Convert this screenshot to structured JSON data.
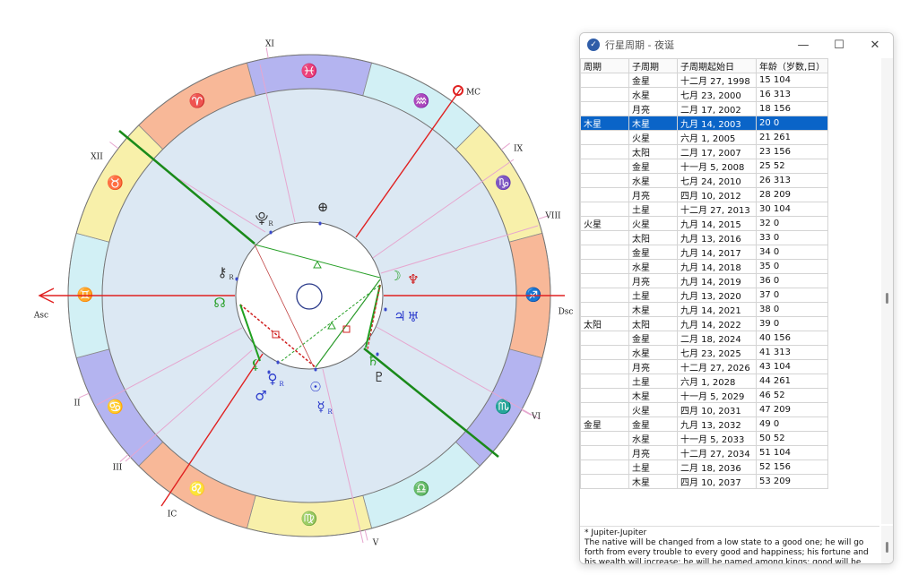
{
  "chart": {
    "angles": {
      "asc": "Asc",
      "dsc": "Dsc",
      "mc": "MC",
      "ic": "IC"
    },
    "houses": [
      "II",
      "III",
      "V",
      "VI",
      "VIII",
      "IX",
      "XI",
      "XII"
    ],
    "signs": [
      {
        "name": "pisces",
        "glyph": "♓",
        "color": "#b4b4f0"
      },
      {
        "name": "aquarius",
        "glyph": "♒",
        "color": "#d2f0f5"
      },
      {
        "name": "capricorn",
        "glyph": "♑",
        "color": "#f8f0aa"
      },
      {
        "name": "sagittarius",
        "glyph": "♐",
        "color": "#f8b898"
      },
      {
        "name": "scorpio",
        "glyph": "♏",
        "color": "#b4b4f0"
      },
      {
        "name": "libra",
        "glyph": "♎",
        "color": "#d2f0f5"
      },
      {
        "name": "virgo",
        "glyph": "♍",
        "color": "#f8f0aa"
      },
      {
        "name": "leo",
        "glyph": "♌",
        "color": "#f8b898"
      },
      {
        "name": "cancer",
        "glyph": "♋",
        "color": "#b4b4f0"
      },
      {
        "name": "gemini",
        "glyph": "♊",
        "color": "#d2f0f5"
      },
      {
        "name": "taurus",
        "glyph": "♉",
        "color": "#f8f0aa"
      },
      {
        "name": "aries",
        "glyph": "♈",
        "color": "#f8b898"
      }
    ],
    "planets": {
      "pluto_r": "⯓",
      "fortune": "⊕",
      "chiron_r": "⚷",
      "node": "☊",
      "moon": "☽",
      "neptune": "♆",
      "jupiter": "♃",
      "uranus": "♅",
      "saturn": "♄",
      "pluto": "♇",
      "venus_r": "♀",
      "mars": "♂",
      "sun": "☉",
      "mercury_r": "☿",
      "lilith": "⚸",
      "retro": "R"
    }
  },
  "window": {
    "title": "行星周期 - 夜诞",
    "controls": {
      "minimize": "—",
      "maximize": "☐",
      "close": "✕"
    },
    "columns": [
      "周期",
      "子周期",
      "子周期起始日",
      "年龄（岁数,日）"
    ],
    "rows": [
      [
        "",
        "金星",
        "十二月 27, 1998",
        "15 104"
      ],
      [
        "",
        "水星",
        "七月 23, 2000",
        "16 313"
      ],
      [
        "",
        "月亮",
        "二月 17, 2002",
        "18 156"
      ],
      [
        "木星",
        "木星",
        "九月 14, 2003",
        "20 0"
      ],
      [
        "",
        "火星",
        "六月 1, 2005",
        "21 261"
      ],
      [
        "",
        "太阳",
        "二月 17, 2007",
        "23 156"
      ],
      [
        "",
        "金星",
        "十一月 5, 2008",
        "25 52"
      ],
      [
        "",
        "水星",
        "七月 24, 2010",
        "26 313"
      ],
      [
        "",
        "月亮",
        "四月 10, 2012",
        "28 209"
      ],
      [
        "",
        "土星",
        "十二月 27, 2013",
        "30 104"
      ],
      [
        "火星",
        "火星",
        "九月 14, 2015",
        "32 0"
      ],
      [
        "",
        "太阳",
        "九月 13, 2016",
        "33 0"
      ],
      [
        "",
        "金星",
        "九月 14, 2017",
        "34 0"
      ],
      [
        "",
        "水星",
        "九月 14, 2018",
        "35 0"
      ],
      [
        "",
        "月亮",
        "九月 14, 2019",
        "36 0"
      ],
      [
        "",
        "土星",
        "九月 13, 2020",
        "37 0"
      ],
      [
        "",
        "木星",
        "九月 14, 2021",
        "38 0"
      ],
      [
        "太阳",
        "太阳",
        "九月 14, 2022",
        "39 0"
      ],
      [
        "",
        "金星",
        "二月 18, 2024",
        "40 156"
      ],
      [
        "",
        "水星",
        "七月 23, 2025",
        "41 313"
      ],
      [
        "",
        "月亮",
        "十二月 27, 2026",
        "43 104"
      ],
      [
        "",
        "土星",
        "六月 1, 2028",
        "44 261"
      ],
      [
        "",
        "木星",
        "十一月 5, 2029",
        "46 52"
      ],
      [
        "",
        "火星",
        "四月 10, 2031",
        "47 209"
      ],
      [
        "金星",
        "金星",
        "九月 13, 2032",
        "49 0"
      ],
      [
        "",
        "水星",
        "十一月 5, 2033",
        "50 52"
      ],
      [
        "",
        "月亮",
        "十二月 27, 2034",
        "51 104"
      ],
      [
        "",
        "土星",
        "二月 18, 2036",
        "52 156"
      ],
      [
        "",
        "木星",
        "四月 10, 2037",
        "53 209"
      ]
    ],
    "selected_row": 3,
    "description": {
      "title": "* Jupiter-Jupiter",
      "text": "The native will be changed from a low state to a good one; he will go forth from every trouble to every good and happiness; his fortune and his wealth will increase; he will be named among kings; good will be spoken of him; he will have an honorable and great rank. And if Jupiter in the radix is in his own bound or in the bound"
    }
  }
}
